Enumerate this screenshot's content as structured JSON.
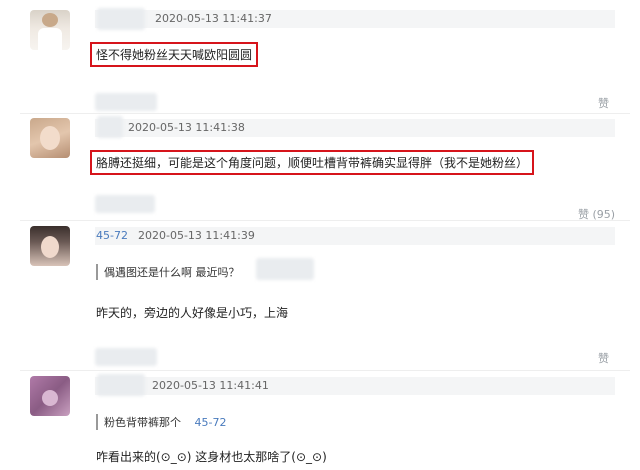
{
  "comments": [
    {
      "time": "2020-05-13 11:41:37",
      "text": "怪不得她粉丝天天喊欧阳圆圆"
    },
    {
      "time": "2020-05-13 11:41:38",
      "text": "胳膊还挺细，可能是这个角度问题，顺便吐槽背带裤确实显得胖（我不是她粉丝）",
      "like_label": "赞"
    },
    {
      "user_id": "45-72",
      "time": "2020-05-13 11:41:39",
      "quote": "偶遇图还是什么啊 最近吗？",
      "text": "昨天的，旁边的人好像是小巧，上海",
      "like_label": "赞 (95)"
    },
    {
      "time": "2020-05-13 11:41:41",
      "quote": "粉色背带裤那个",
      "quote_user": "45-72",
      "text": "咋看出来的(⊙_⊙) 这身材也太那啥了(⊙_⊙)",
      "like_label": "赞"
    }
  ],
  "colors": {
    "highlight": "#d6141b",
    "link": "#4a7bbd",
    "meta_band": "#f4f5f6"
  }
}
